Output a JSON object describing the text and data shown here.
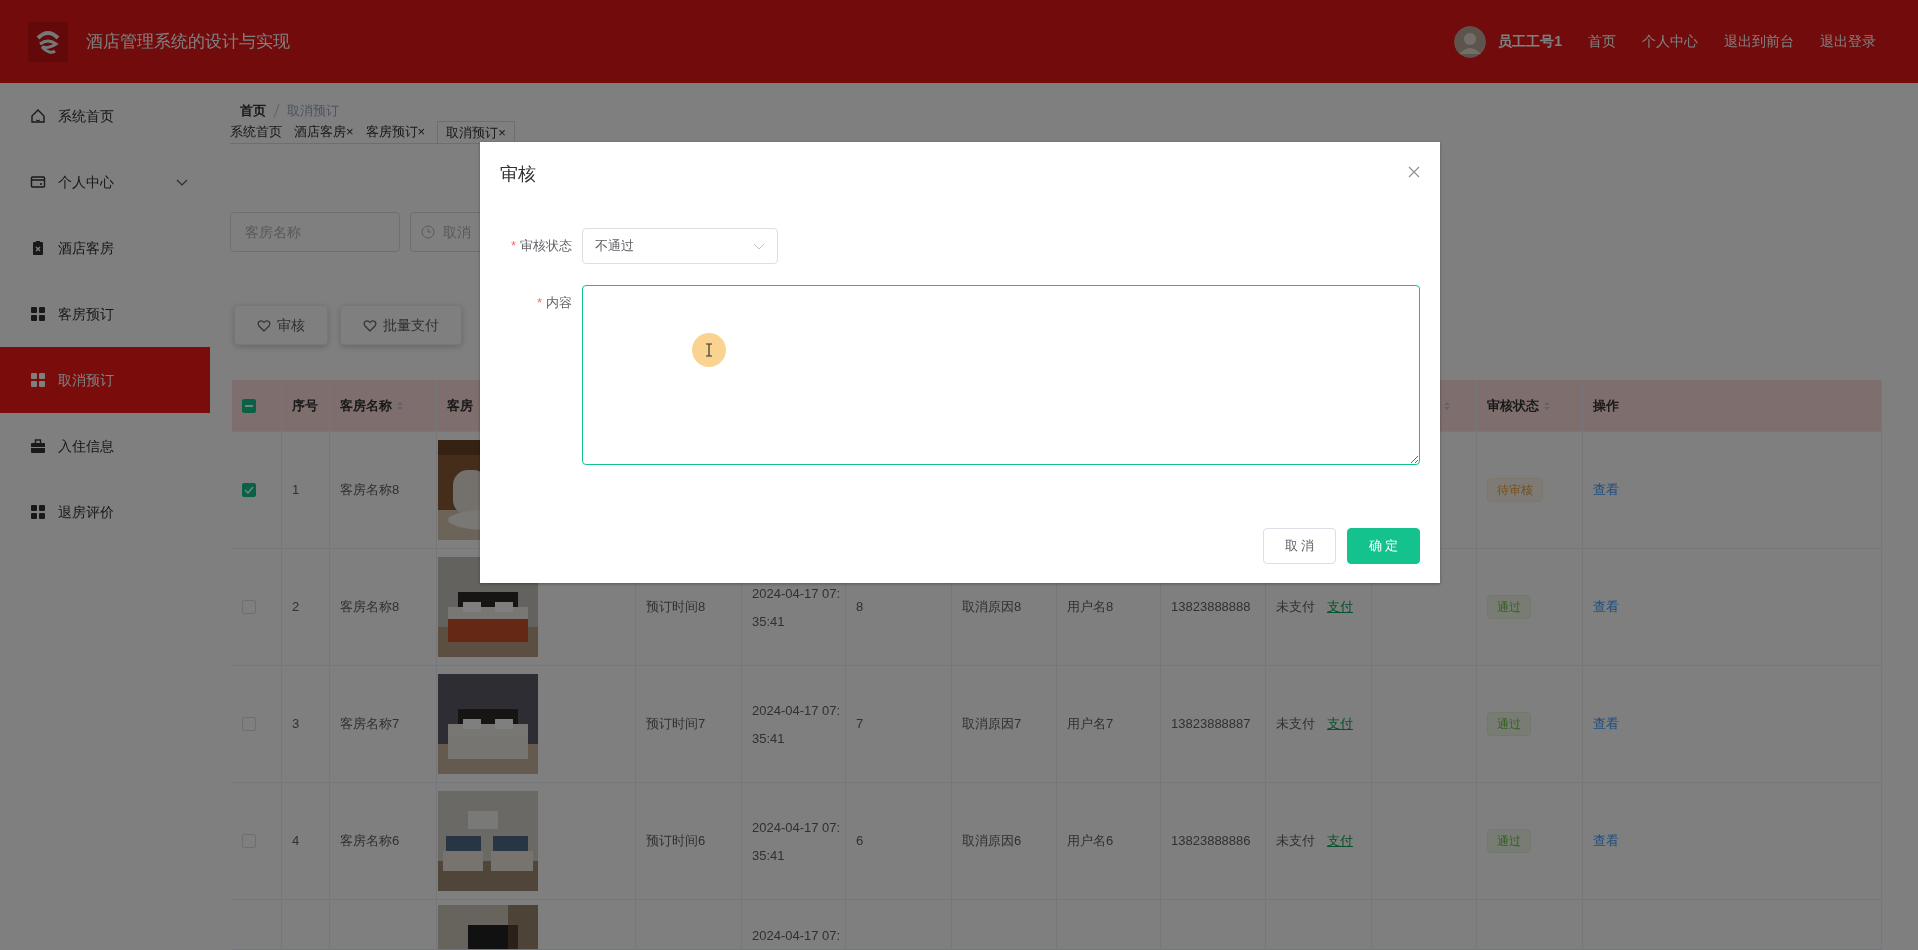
{
  "header": {
    "title": "酒店管理系统的设计与实现",
    "user": "员工工号1",
    "links": [
      "首页",
      "个人中心",
      "退出到前台",
      "退出登录"
    ]
  },
  "sidebar": {
    "items": [
      {
        "label": "系统首页",
        "selected": false,
        "kind": "item"
      },
      {
        "label": "个人中心",
        "selected": false,
        "kind": "submenu"
      },
      {
        "label": "酒店客房",
        "selected": false,
        "kind": "item"
      },
      {
        "label": "客房预订",
        "selected": false,
        "kind": "item"
      },
      {
        "label": "取消预订",
        "selected": true,
        "kind": "item"
      },
      {
        "label": "入住信息",
        "selected": false,
        "kind": "item"
      },
      {
        "label": "退房评价",
        "selected": false,
        "kind": "item"
      }
    ]
  },
  "breadcrumb": [
    "首页",
    "取消预订"
  ],
  "tabs": [
    {
      "label": "系统首页",
      "selected": false
    },
    {
      "label": "酒店客房",
      "close": "×",
      "selected": false
    },
    {
      "label": "客房预订",
      "close": "×",
      "selected": false
    },
    {
      "label": "取消预订×",
      "selected": true
    }
  ],
  "search": {
    "fields": [
      {
        "kind": "text",
        "placeholder": "客房名称"
      },
      {
        "kind": "date",
        "placeholder": "取消"
      }
    ]
  },
  "actions": [
    {
      "label": "审核"
    },
    {
      "label": "批量支付"
    }
  ],
  "table": {
    "header_checkbox": {
      "indeterminate": true
    },
    "columns": [
      {
        "label": "序号",
        "sortable": false
      },
      {
        "label": "客房名称",
        "sortable": true
      },
      {
        "label": "客房",
        "sortable": false
      },
      {},
      {},
      {},
      {},
      {},
      {},
      {},
      {
        "sortable": true
      },
      {
        "label": "审核状态",
        "sortable": true
      },
      {
        "label": "操作",
        "sortable": false
      }
    ],
    "rows": [
      {
        "selected": true,
        "no": "1",
        "name": "客房名称8",
        "audit": {
          "label": "待审核",
          "kind": "pending"
        },
        "action": "查看"
      },
      {
        "selected": false,
        "no": "2",
        "name": "客房名称8",
        "booking_time": "预订时间8",
        "cancel_time": "2024-04-17 07:35:41",
        "column_6": "8",
        "reason": "取消原因8",
        "user": "用户名8",
        "phone": "13823888888",
        "pay_status": "未支付",
        "pay_action": "支付",
        "audit": {
          "label": "通过",
          "kind": "passed"
        },
        "action": "查看"
      },
      {
        "selected": false,
        "no": "3",
        "name": "客房名称7",
        "booking_time": "预订时间7",
        "cancel_time": "2024-04-17 07:35:41",
        "column_6": "7",
        "reason": "取消原因7",
        "user": "用户名7",
        "phone": "13823888887",
        "pay_status": "未支付",
        "pay_action": "支付",
        "audit": {
          "label": "通过",
          "kind": "passed"
        },
        "action": "查看"
      },
      {
        "selected": false,
        "no": "4",
        "name": "客房名称6",
        "booking_time": "预订时间6",
        "cancel_time": "2024-04-17 07:35:41",
        "column_6": "6",
        "reason": "取消原因6",
        "user": "用户名6",
        "phone": "13823888886",
        "pay_status": "未支付",
        "pay_action": "支付",
        "audit": {
          "label": "通过",
          "kind": "passed"
        },
        "action": "查看"
      },
      {
        "cancel_time": "2024-04-17 07:"
      }
    ]
  },
  "dialog": {
    "title": "审核",
    "fields": [
      {
        "kind": "select",
        "label": "审核状态",
        "required_mark": "*",
        "value": "不通过"
      },
      {
        "kind": "textarea",
        "label": "内容",
        "required_mark": "*",
        "focused": true
      }
    ],
    "buttons": [
      {
        "label": "取 消",
        "kind": "default"
      },
      {
        "label": "确 定",
        "kind": "primary"
      }
    ]
  }
}
